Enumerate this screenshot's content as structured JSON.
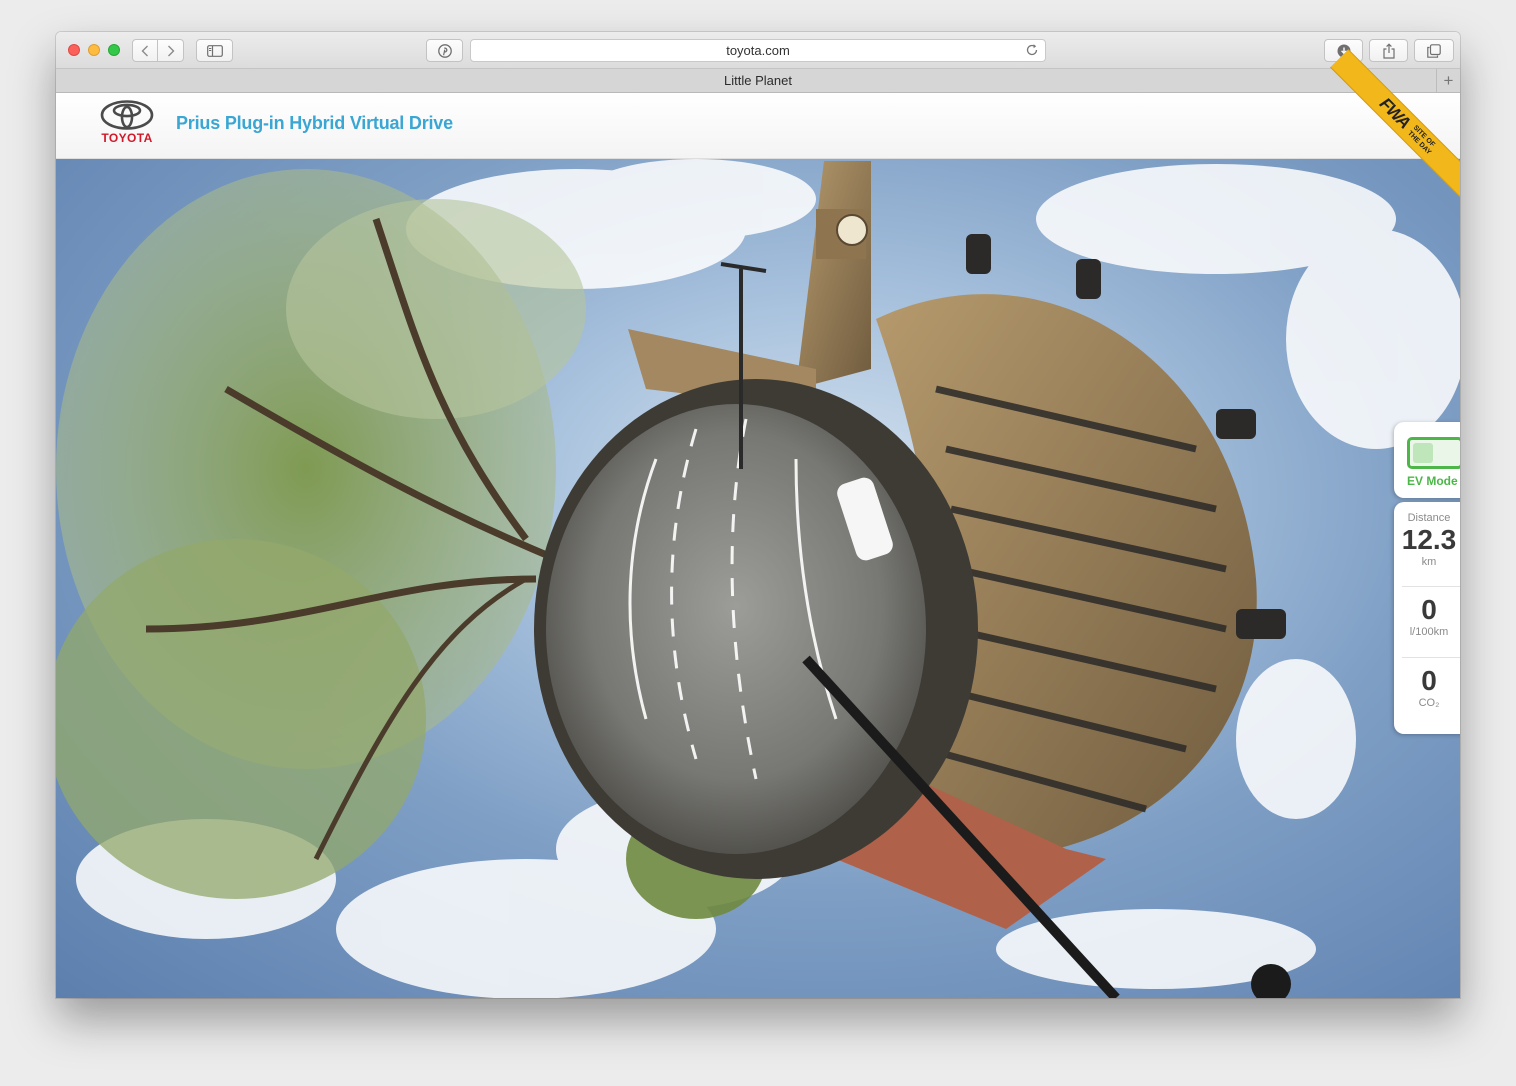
{
  "browser": {
    "url": "toyota.com",
    "tab_title": "Little Planet",
    "new_tab_symbol": "+"
  },
  "site": {
    "brand": "TOYOTA",
    "title": "Prius Plug-in Hybrid Virtual Drive",
    "brand_color": "#d1192a",
    "title_color": "#3aa6d3"
  },
  "award": {
    "logo": "FWA",
    "label": "Site of the day",
    "color": "#f2b81b"
  },
  "ev_mode": {
    "label": "EV Mode",
    "color": "#4cb748"
  },
  "stats": {
    "distance_label": "Distance",
    "distance_value": "12.3",
    "distance_unit": "km",
    "fuel_value": "0",
    "fuel_unit": "l/100km",
    "co2_value": "0",
    "co2_unit": "CO₂"
  },
  "icons": {
    "back": "chevron-left-icon",
    "forward": "chevron-right-icon",
    "sidebar": "sidebar-icon",
    "pinterest": "pinterest-icon",
    "reload": "reload-icon",
    "download": "download-icon",
    "share": "share-icon",
    "tabs": "tabs-icon"
  }
}
